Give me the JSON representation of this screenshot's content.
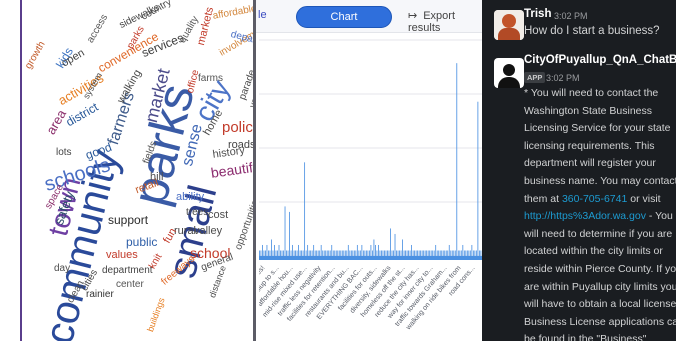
{
  "wordcloud": {
    "words": [
      {
        "text": "community",
        "color": "#2a4a9a",
        "size": 41,
        "rot": -76,
        "l": 16,
        "t": 338
      },
      {
        "text": "parks",
        "color": "#3a5ba6",
        "size": 50,
        "rot": -76,
        "l": 102,
        "t": 198
      },
      {
        "text": "small",
        "color": "#2c3f8c",
        "size": 40,
        "rot": -76,
        "l": 140,
        "t": 272
      },
      {
        "text": "town",
        "color": "#6e3fa3",
        "size": 28,
        "rot": -76,
        "l": 22,
        "t": 232
      },
      {
        "text": "city",
        "color": "#4d74c7",
        "size": 28,
        "rot": -60,
        "l": 168,
        "t": 112
      },
      {
        "text": "schools",
        "color": "#4a6fc4",
        "size": 20,
        "rot": -18,
        "l": 20,
        "t": 176
      },
      {
        "text": "farmers",
        "color": "#3d5a8a",
        "size": 16,
        "rot": -72,
        "l": 84,
        "t": 142
      },
      {
        "text": "market",
        "color": "#4b4b8a",
        "size": 18,
        "rot": -76,
        "l": 120,
        "t": 120
      },
      {
        "text": "sense",
        "color": "#3f67b5",
        "size": 16,
        "rot": -76,
        "l": 158,
        "t": 164
      },
      {
        "text": "police",
        "color": "#c23b2a",
        "size": 15,
        "rot": 0,
        "l": 200,
        "t": 120
      },
      {
        "text": "beautiful",
        "color": "#8b2b6e",
        "size": 14,
        "rot": -8,
        "l": 188,
        "t": 166
      },
      {
        "text": "activities",
        "color": "#e67e22",
        "size": 13,
        "rot": -30,
        "l": 34,
        "t": 96
      },
      {
        "text": "district",
        "color": "#2a5a9a",
        "size": 12,
        "rot": -30,
        "l": 42,
        "t": 118
      },
      {
        "text": "area",
        "color": "#8a2d6a",
        "size": 13,
        "rot": -60,
        "l": 22,
        "t": 130
      },
      {
        "text": "kids",
        "color": "#3d74c2",
        "size": 12,
        "rot": -60,
        "l": 32,
        "t": 64
      },
      {
        "text": "open",
        "color": "#444",
        "size": 11,
        "rot": -30,
        "l": 38,
        "t": 60
      },
      {
        "text": "convenience",
        "color": "#e06a2a",
        "size": 12,
        "rot": -30,
        "l": 74,
        "t": 64
      },
      {
        "text": "services",
        "color": "#3b3b3b",
        "size": 12,
        "rot": -22,
        "l": 118,
        "t": 48
      },
      {
        "text": "sidewalks",
        "color": "#444",
        "size": 10,
        "rot": -26,
        "l": 96,
        "t": 22
      },
      {
        "text": "markets",
        "color": "#c23b2a",
        "size": 11,
        "rot": -76,
        "l": 174,
        "t": 44
      },
      {
        "text": "involvement",
        "color": "#d2853a",
        "size": 10,
        "rot": -30,
        "l": 196,
        "t": 50
      },
      {
        "text": "department",
        "color": "#4a6fc4",
        "size": 10,
        "rot": 14,
        "l": 210,
        "t": 30
      },
      {
        "text": "walking",
        "color": "#4b4b4b",
        "size": 11,
        "rot": -60,
        "l": 94,
        "t": 100
      },
      {
        "text": "good",
        "color": "#2a5a9a",
        "size": 12,
        "rot": -20,
        "l": 62,
        "t": 150
      },
      {
        "text": "retail",
        "color": "#c25b2a",
        "size": 11,
        "rot": -20,
        "l": 112,
        "t": 186
      },
      {
        "text": "safety",
        "color": "#2a4a6a",
        "size": 13,
        "rot": -70,
        "l": 30,
        "t": 222
      },
      {
        "text": "support",
        "color": "#2b2b2b",
        "size": 12,
        "rot": 0,
        "l": 86,
        "t": 214
      },
      {
        "text": "public",
        "color": "#2f5fa8",
        "size": 12,
        "rot": 0,
        "l": 104,
        "t": 236
      },
      {
        "text": "values",
        "color": "#c23b2a",
        "size": 11,
        "rot": 0,
        "l": 84,
        "t": 250
      },
      {
        "text": "department",
        "color": "#444",
        "size": 10,
        "rot": 0,
        "l": 80,
        "t": 266
      },
      {
        "text": "center",
        "color": "#555",
        "size": 10,
        "rot": 0,
        "l": 94,
        "t": 280
      },
      {
        "text": "rainier",
        "color": "#333",
        "size": 10,
        "rot": 0,
        "l": 64,
        "t": 290
      },
      {
        "text": "school",
        "color": "#c23b2a",
        "size": 14,
        "rot": 0,
        "l": 168,
        "t": 246
      },
      {
        "text": "general",
        "color": "#4d4d4d",
        "size": 10,
        "rot": -20,
        "l": 178,
        "t": 264
      },
      {
        "text": "rural",
        "color": "#444",
        "size": 11,
        "rot": 0,
        "l": 152,
        "t": 226
      },
      {
        "text": "valley",
        "color": "#4d4d4d",
        "size": 11,
        "rot": 0,
        "l": 172,
        "t": 226
      },
      {
        "text": "fun",
        "color": "#c23b2a",
        "size": 11,
        "rot": -60,
        "l": 140,
        "t": 240
      },
      {
        "text": "ability",
        "color": "#4a6fc4",
        "size": 11,
        "rot": 0,
        "l": 154,
        "t": 192
      },
      {
        "text": "trees",
        "color": "#444",
        "size": 10,
        "rot": 0,
        "l": 164,
        "t": 208
      },
      {
        "text": "cost",
        "color": "#4d4d4d",
        "size": 11,
        "rot": 0,
        "l": 186,
        "t": 210
      },
      {
        "text": "history",
        "color": "#4d4d4d",
        "size": 11,
        "rot": -8,
        "l": 190,
        "t": 150
      },
      {
        "text": "home",
        "color": "#4b4b4b",
        "size": 11,
        "rot": -60,
        "l": 180,
        "t": 132
      },
      {
        "text": "roads",
        "color": "#444",
        "size": 11,
        "rot": 0,
        "l": 206,
        "t": 140
      },
      {
        "text": "opportunities",
        "color": "#555",
        "size": 10,
        "rot": -70,
        "l": 212,
        "t": 248
      },
      {
        "text": "lots",
        "color": "#444",
        "size": 10,
        "rot": 0,
        "l": 34,
        "t": 148
      },
      {
        "text": "clean",
        "color": "#4d4d4d",
        "size": 10,
        "rot": -60,
        "l": 44,
        "t": 300
      },
      {
        "text": "cities",
        "color": "#444",
        "size": 10,
        "rot": -60,
        "l": 58,
        "t": 288
      },
      {
        "text": "freeways",
        "color": "#e06a2a",
        "size": 10,
        "rot": -40,
        "l": 138,
        "t": 280
      },
      {
        "text": "distance",
        "color": "#4d4d4d",
        "size": 9,
        "rot": -70,
        "l": 186,
        "t": 296
      },
      {
        "text": "buildings",
        "color": "#e67e22",
        "size": 9,
        "rot": -70,
        "l": 124,
        "t": 330
      },
      {
        "text": "day",
        "color": "#4d4d4d",
        "size": 10,
        "rot": 0,
        "l": 32,
        "t": 264
      },
      {
        "text": "space",
        "color": "#8a2d6a",
        "size": 10,
        "rot": -60,
        "l": 22,
        "t": 206
      },
      {
        "text": "hill",
        "color": "#4d4d4d",
        "size": 11,
        "rot": 0,
        "l": 128,
        "t": 172
      },
      {
        "text": "office",
        "color": "#c23b2a",
        "size": 10,
        "rot": -76,
        "l": 164,
        "t": 92
      },
      {
        "text": "farms",
        "color": "#555",
        "size": 10,
        "rot": 0,
        "l": 176,
        "t": 74
      },
      {
        "text": "parade",
        "color": "#4d4d4d",
        "size": 10,
        "rot": -70,
        "l": 216,
        "t": 98
      },
      {
        "text": "various",
        "color": "#555",
        "size": 9,
        "rot": -70,
        "l": 226,
        "t": 106
      },
      {
        "text": "growth",
        "color": "#c25b2a",
        "size": 10,
        "rot": -60,
        "l": 2,
        "t": 66
      },
      {
        "text": "access",
        "color": "#555",
        "size": 10,
        "rot": -60,
        "l": 64,
        "t": 40
      },
      {
        "text": "quality",
        "color": "#555",
        "size": 10,
        "rot": -60,
        "l": 156,
        "t": 40
      },
      {
        "text": "knit",
        "color": "#c23b2a",
        "size": 10,
        "rot": -60,
        "l": 126,
        "t": 266
      },
      {
        "text": "traditions",
        "color": "#555",
        "size": 9,
        "rot": -70,
        "l": 230,
        "t": 244
      },
      {
        "text": "affordable",
        "color": "#d2853a",
        "size": 10,
        "rot": -10,
        "l": 190,
        "t": 12
      },
      {
        "text": "country",
        "color": "#4d4d4d",
        "size": 10,
        "rot": -30,
        "l": 118,
        "t": 14
      },
      {
        "text": "parks",
        "color": "#c23b2a",
        "size": 10,
        "rot": -60,
        "l": 104,
        "t": 46
      },
      {
        "text": "fields",
        "color": "#555",
        "size": 10,
        "rot": -70,
        "l": 120,
        "t": 162
      },
      {
        "text": "system",
        "color": "#4d4d4d",
        "size": 9,
        "rot": -60,
        "l": 60,
        "t": 96
      }
    ]
  },
  "chartpanel": {
    "tab_table": "le",
    "tab_chart": "Chart",
    "export_icon": "export-arrow-icon",
    "export_label": "Export results",
    "colors": {
      "accent": "#2f6fdc",
      "bar": "#4a90e2",
      "grid": "#e4e6eb"
    },
    "chart_data": {
      "type": "bar",
      "grid": "on",
      "categories": [
        "Homes!",
        "like Puyallup to s...",
        "Up to affordable hou...",
        "mid-rise mixed use...",
        "traffic less negativity",
        "facilities for retention...",
        "restaurants and bu...",
        "EVERYTHING BAC...",
        "facilities for outs...",
        "diversity, sidewalks",
        "homeless off the st...",
        "reduce the city has...",
        "way for inner city to...",
        "traffic towards Graham...",
        "walking on ride bikes from",
        "road cons..."
      ],
      "values": [
        1,
        1,
        2,
        1,
        1,
        2,
        1,
        1,
        3,
        1,
        2,
        1,
        1,
        2,
        1,
        1,
        1,
        9,
        1,
        1,
        8,
        1,
        2,
        1,
        1,
        1,
        2,
        1,
        1,
        1,
        17,
        1,
        2,
        1,
        1,
        1,
        2,
        1,
        1,
        1,
        1,
        2,
        1,
        1,
        1,
        1,
        1,
        1,
        2,
        1,
        1,
        1,
        1,
        1,
        1,
        1,
        1,
        1,
        1,
        2,
        1,
        1,
        1,
        1,
        1,
        2,
        1,
        1,
        2,
        1,
        1,
        1,
        1,
        1,
        2,
        1,
        3,
        2,
        1,
        2,
        1,
        1,
        1,
        1,
        1,
        1,
        1,
        5,
        1,
        1,
        4,
        1,
        1,
        1,
        1,
        3,
        1,
        1,
        1,
        1,
        1,
        2,
        1,
        1,
        1,
        1,
        1,
        1,
        1,
        1,
        1,
        1,
        1,
        1,
        1,
        1,
        1,
        2,
        1,
        1,
        1,
        1,
        1,
        1,
        1,
        1,
        2,
        1,
        1,
        1,
        1,
        35,
        1,
        1,
        1,
        2,
        1,
        1,
        1,
        1,
        1,
        2,
        1,
        1,
        1,
        28,
        1,
        1,
        1,
        1
      ]
    }
  },
  "chat": {
    "msg1": {
      "user": "Trish",
      "time": "3:02 PM",
      "text": "How do I start a business?"
    },
    "msg2": {
      "user": "CityOfPuyallup_QnA_ChatBot",
      "badge": "APP",
      "time": "3:02 PM",
      "text_a": "* You will need to contact the Washington State Business Licensing Service for your state licensing requirements. This department will register your business name. You may contact them at ",
      "phone": "360-705-6741",
      "text_b": " or visit ",
      "link": "http://https%3Ador.wa.gov",
      "text_c": " - You will need to determine if you are located within the city limits or reside within Pierce County. If you are within Puyallup city limits you will have to obtain a local license. Business License applications can be found in the \"Business\""
    },
    "colors": {
      "bg": "#1a1d21",
      "link": "#1d9bd1",
      "text": "#d1d2d3"
    }
  }
}
